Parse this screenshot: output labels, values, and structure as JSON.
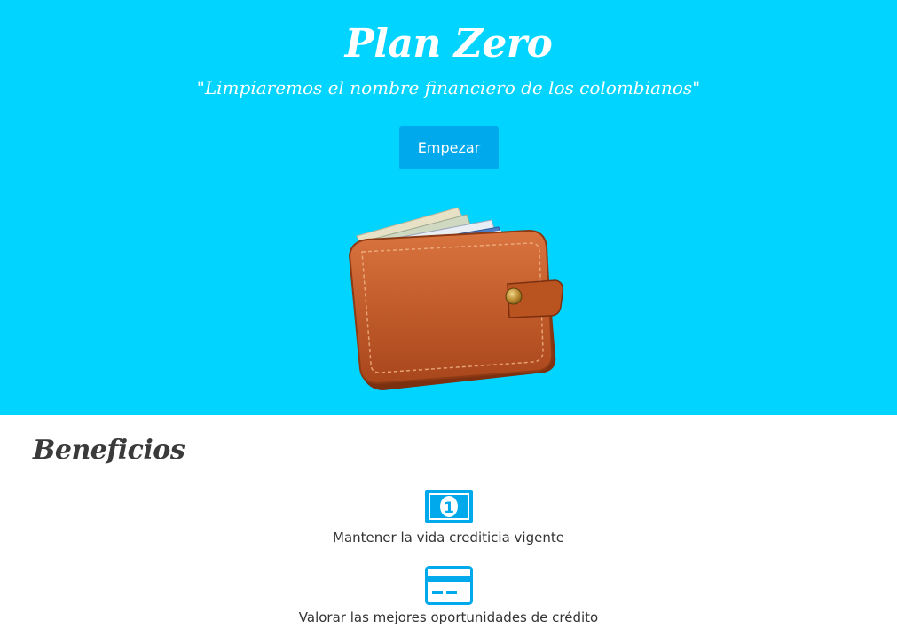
{
  "hero": {
    "title": "Plan Zero",
    "subtitle": "\"Limpiaremos el nombre financiero de los colombianos\"",
    "start_button": "Empezar",
    "image": "wallet-illustration"
  },
  "benefits": {
    "title": "Beneficios",
    "items": [
      {
        "icon": "money-bill-icon",
        "label": "Mantener la vida crediticia vigente"
      },
      {
        "icon": "credit-card-icon",
        "label": "Valorar las mejores oportunidades de crédito"
      }
    ]
  },
  "colors": {
    "hero_background": "#00d4ff",
    "button_background": "#00a8ec",
    "icon_color": "#00a8ec",
    "heading_text": "#3a3a3a"
  }
}
